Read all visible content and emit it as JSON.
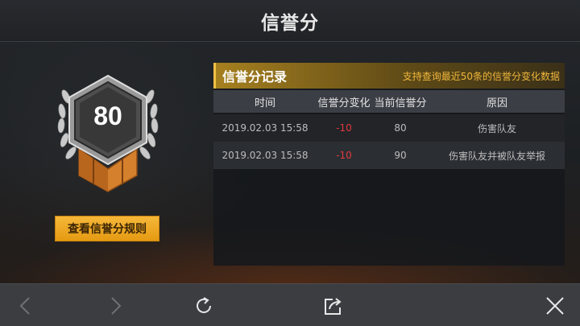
{
  "header": {
    "title": "信誉分"
  },
  "badge": {
    "score": "80"
  },
  "rules_button": {
    "label": "查看信誉分规则"
  },
  "record": {
    "title": "信誉分记录",
    "hint": "支持查询最近50条的信誉分变化数据",
    "columns": [
      "时间",
      "信誉分变化",
      "当前信誉分",
      "原因"
    ],
    "rows": [
      {
        "time": "2019.02.03 15:58",
        "change": "-10",
        "current": "80",
        "reason": "伤害队友"
      },
      {
        "time": "2019.02.03 15:58",
        "change": "-10",
        "current": "90",
        "reason": "伤害队友并被队友举报"
      }
    ]
  },
  "colors": {
    "accent": "#f0b73a",
    "button": "#f2a623",
    "negative": "#e23a3a"
  },
  "bottom_nav": {
    "icons": [
      "back-icon",
      "forward-icon",
      "refresh-icon",
      "share-icon",
      "close-icon"
    ]
  }
}
